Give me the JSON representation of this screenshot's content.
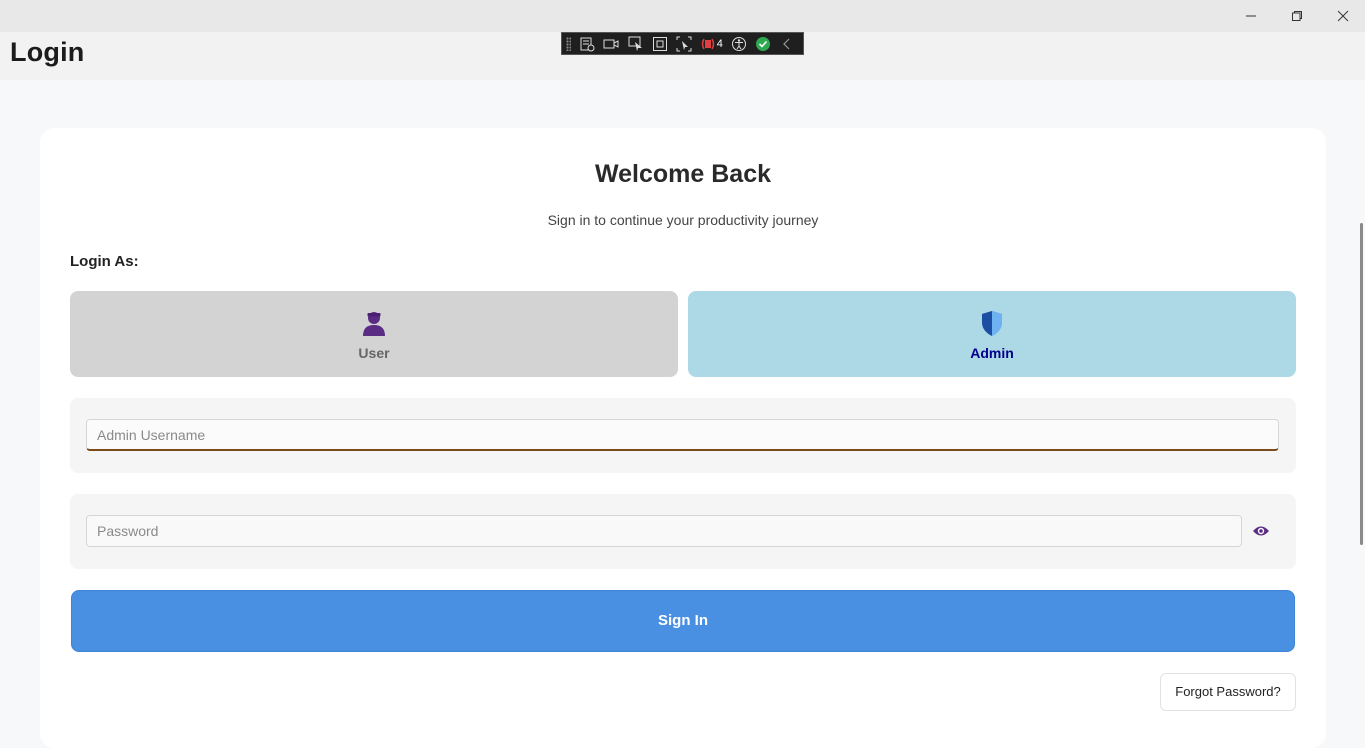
{
  "window": {
    "controls": [
      "minimize-icon",
      "maximize-icon",
      "close-icon"
    ]
  },
  "page": {
    "title": "Login"
  },
  "devbar": {
    "tools": [
      "live-visual-tree-icon",
      "video-icon",
      "select-element-icon",
      "display-layout-adorners-icon",
      "track-focus-icon",
      "binding-failures-icon",
      "accessibility-icon",
      "hot-reload-ok-icon",
      "collapse-icon"
    ],
    "binding_failures": "4"
  },
  "card": {
    "heading": "Welcome Back",
    "subtitle": "Sign in to continue your productivity journey",
    "login_as_label": "Login As:",
    "roles": {
      "user": {
        "label": "User",
        "icon": "person-icon",
        "selected": false
      },
      "admin": {
        "label": "Admin",
        "icon": "shield-icon",
        "selected": true
      }
    },
    "username": {
      "placeholder": "Admin Username",
      "value": ""
    },
    "password": {
      "placeholder": "Password",
      "value": "",
      "toggle_icon": "eye-icon"
    },
    "sign_in_label": "Sign In",
    "forgot_label": "Forgot Password?"
  },
  "colors": {
    "accent": "#4a90e2",
    "admin_selected_bg": "#add8e6",
    "user_bg": "#d3d3d3",
    "icon_purple": "#5b2c83",
    "admin_label": "#00008b"
  }
}
